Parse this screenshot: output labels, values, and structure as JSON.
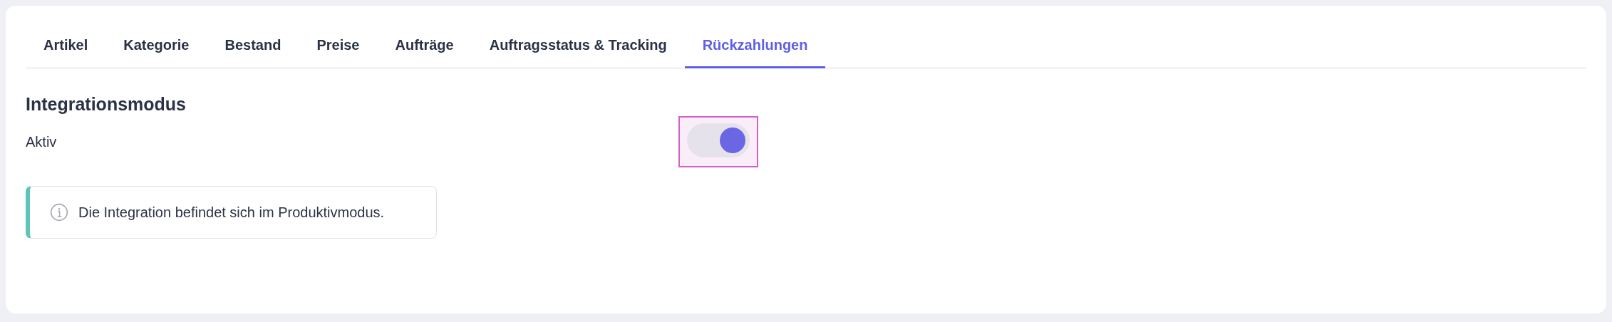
{
  "tabs": [
    {
      "label": "Artikel",
      "selected": false
    },
    {
      "label": "Kategorie",
      "selected": false
    },
    {
      "label": "Bestand",
      "selected": false
    },
    {
      "label": "Preise",
      "selected": false
    },
    {
      "label": "Aufträge",
      "selected": false
    },
    {
      "label": "Auftragsstatus & Tracking",
      "selected": false
    },
    {
      "label": "Rückzahlungen",
      "selected": true
    }
  ],
  "section": {
    "title": "Integrationsmodus",
    "setting": {
      "label": "Aktiv",
      "on": true,
      "focused": true
    },
    "notice": {
      "text": "Die Integration befindet sich im Produktivmodus."
    }
  }
}
